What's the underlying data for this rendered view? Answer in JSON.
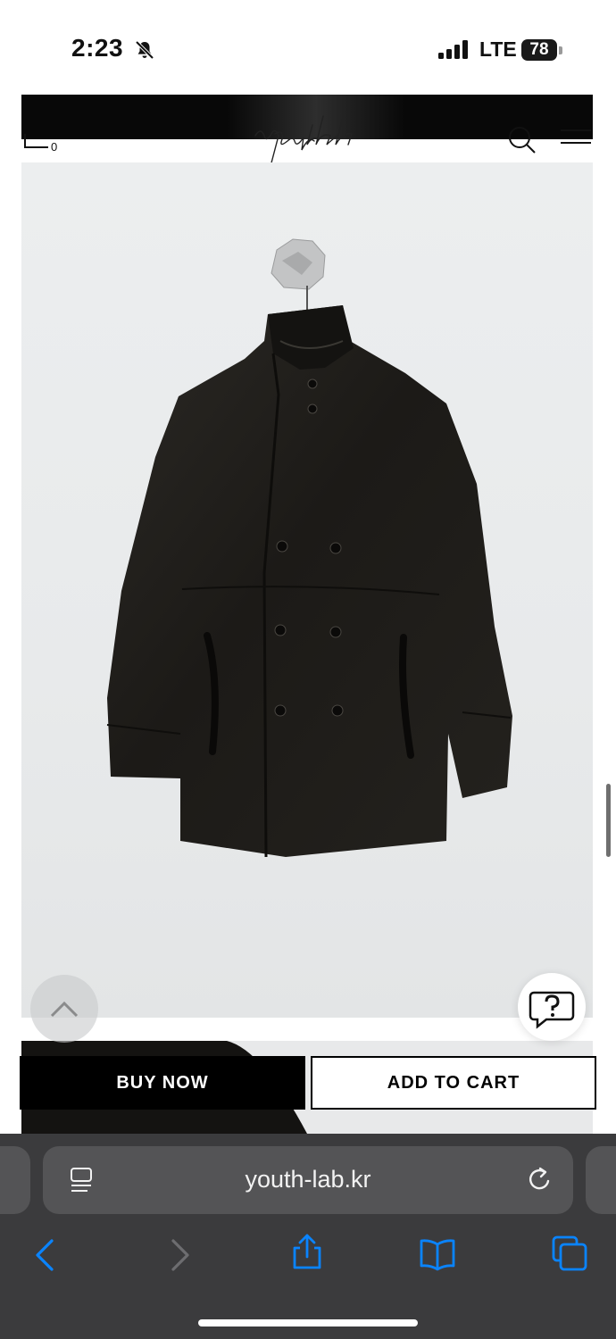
{
  "status_bar": {
    "time": "2:23",
    "network": "LTE",
    "battery": "78",
    "icons": [
      "bell-slash-icon",
      "signal-icon",
      "battery-icon"
    ]
  },
  "header": {
    "logo_text": "youth",
    "cart_count": "0",
    "icons": [
      "cart-icon",
      "search-icon",
      "menu-icon"
    ]
  },
  "product": {
    "image_alt": "black leather double-breasted jacket hanging on a wall"
  },
  "actions": {
    "buy_now": "BUY NOW",
    "add_to_cart": "ADD TO CART"
  },
  "floating": {
    "scroll_top_icon": "chevron-up-icon",
    "help_icon": "question-chat-icon"
  },
  "browser": {
    "url": "youth-lab.kr",
    "icons": [
      "reader-icon",
      "reload-icon",
      "back-icon",
      "forward-icon",
      "share-icon",
      "bookmarks-icon",
      "tabs-icon"
    ]
  },
  "colors": {
    "ios_blue": "#0a84ff",
    "toolbar_bg": "#3b3b3d",
    "button_black": "#000000"
  }
}
